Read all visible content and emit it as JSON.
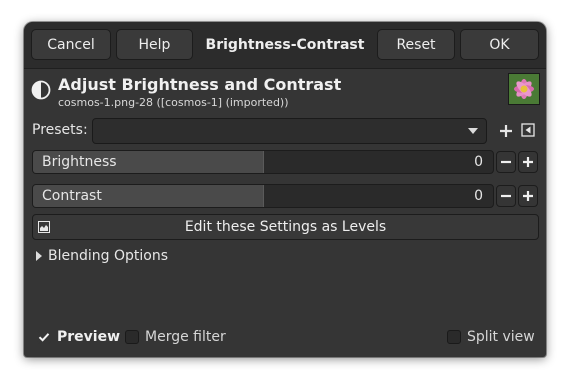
{
  "window": {
    "title": "Brightness-Contrast",
    "buttons": {
      "cancel": "Cancel",
      "help": "Help",
      "reset": "Reset",
      "ok": "OK"
    }
  },
  "header": {
    "title": "Adjust Brightness and Contrast",
    "subtitle": "cosmos-1.png-28 ([cosmos-1] (imported))",
    "icon": "brightness-contrast-icon",
    "thumbnail": "image-thumbnail"
  },
  "presets": {
    "label": "Presets:",
    "value": ""
  },
  "brightness": {
    "label": "Brightness",
    "value": "0",
    "level": 0.5
  },
  "contrast": {
    "label": "Contrast",
    "value": "0",
    "level": 0.5
  },
  "levels_button": {
    "label": "Edit these Settings as Levels"
  },
  "blending": {
    "label": "Blending Options"
  },
  "footer": {
    "preview": {
      "label": "Preview",
      "checked": true
    },
    "merge": {
      "label": "Merge filter",
      "checked": false
    },
    "split": {
      "label": "Split view",
      "checked": false
    }
  },
  "colors": {
    "background": "#353535",
    "header": "#2c2c2c",
    "text": "#e8e8e8"
  }
}
